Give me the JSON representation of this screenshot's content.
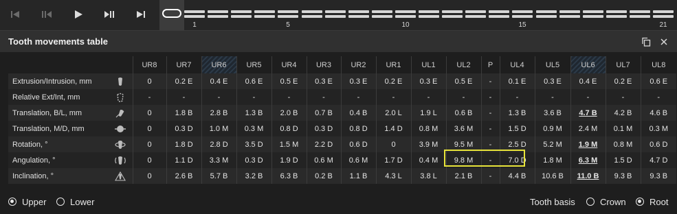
{
  "app_title": "Tooth movements table",
  "step_numbers": [
    "1",
    "5",
    "10",
    "15",
    "21"
  ],
  "columns": [
    "UR8",
    "UR7",
    "UR6",
    "UR5",
    "UR4",
    "UR3",
    "UR2",
    "UR1",
    "UL1",
    "UL2",
    "P",
    "UL4",
    "UL5",
    "UL6",
    "UL7",
    "UL8"
  ],
  "rows": [
    {
      "label": "Extrusion/Intrusion, mm",
      "icon": "extrusion-tooth-icon",
      "values": [
        "0",
        "0.2 E",
        "0.4 E",
        "0.6 E",
        "0.5 E",
        "0.3 E",
        "0.3 E",
        "0.2 E",
        "0.3 E",
        "0.5 E",
        "-",
        "0.1 E",
        "0.3 E",
        "0.4 E",
        "0.2 E",
        "0.6 E"
      ]
    },
    {
      "label": "Relative Ext/Int, mm",
      "icon": "relative-tooth-icon",
      "values": [
        "-",
        "-",
        "-",
        "-",
        "-",
        "-",
        "-",
        "-",
        "-",
        "-",
        "-",
        "-",
        "-",
        "-",
        "-",
        "-"
      ]
    },
    {
      "label": "Translation, B/L, mm",
      "icon": "translation-bl-icon",
      "values": [
        "0",
        "1.8 B",
        "2.8 B",
        "1.3 B",
        "2.0 B",
        "0.7 B",
        "0.4 B",
        "2.0 L",
        "1.9 L",
        "0.6 B",
        "-",
        "1.3 B",
        "3.6 B",
        "4.7 B",
        "4.2 B",
        "4.6 B"
      ]
    },
    {
      "label": "Translation, M/D, mm",
      "icon": "translation-md-icon",
      "values": [
        "0",
        "0.3 D",
        "1.0 M",
        "0.3 M",
        "0.8 D",
        "0.3 D",
        "0.8 D",
        "1.4 D",
        "0.8 M",
        "3.6 M",
        "-",
        "1.5 D",
        "0.9 M",
        "2.4 M",
        "0.1 M",
        "0.3 M"
      ]
    },
    {
      "label": "Rotation, °",
      "icon": "rotation-icon",
      "values": [
        "0",
        "1.8 D",
        "2.8 D",
        "3.5 D",
        "1.5 M",
        "2.2 D",
        "0.6 D",
        "0",
        "3.9 M",
        "9.5 M",
        "-",
        "2.5 D",
        "5.2 M",
        "1.9 M",
        "0.8 M",
        "0.6 D"
      ]
    },
    {
      "label": "Angulation, °",
      "icon": "angulation-icon",
      "values": [
        "0",
        "1.1 D",
        "3.3 M",
        "0.3 D",
        "1.9 D",
        "0.6 M",
        "0.6 M",
        "1.7 D",
        "0.4 M",
        "9.8 M",
        "-",
        "7.0 D",
        "1.8 M",
        "6.3 M",
        "1.5 D",
        "4.7 D"
      ]
    },
    {
      "label": "Inclination, °",
      "icon": "inclination-icon",
      "values": [
        "0",
        "2.6 B",
        "5.7 B",
        "3.2 B",
        "6.3 B",
        "0.2 B",
        "1.1 B",
        "4.3 L",
        "3.8 L",
        "2.1 B",
        "-",
        "4.4 B",
        "10.6 B",
        "11.0 B",
        "9.3 B",
        "9.3 B"
      ]
    }
  ],
  "footer": {
    "upper_label": "Upper",
    "lower_label": "Lower",
    "tooth_basis_label": "Tooth basis",
    "crown_label": "Crown",
    "root_label": "Root"
  },
  "jaw_selected": "Upper",
  "basis_selected": "Root",
  "colors": {
    "highlight": "#e8e43a",
    "background": "#1e1e1e",
    "hatch": "#2c3a48"
  }
}
